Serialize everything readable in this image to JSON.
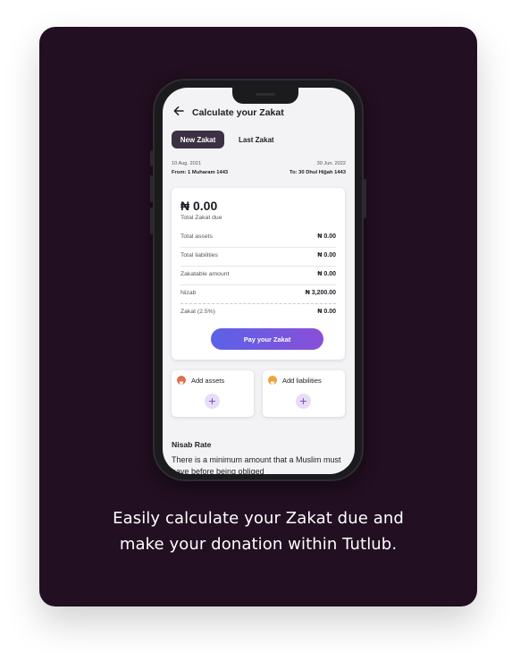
{
  "caption": {
    "line1": "Easily calculate your Zakat due and",
    "line2": "make your donation within Tutlub."
  },
  "app": {
    "header": {
      "title": "Calculate your Zakat",
      "back_icon": "arrow-left-icon"
    },
    "tabs": [
      {
        "label": "New Zakat",
        "active": true
      },
      {
        "label": "Last Zakat",
        "active": false
      }
    ],
    "dates": {
      "start_date": "10 Aug. 2021",
      "start_label": "From: 1 Muharam 1443",
      "end_date": "30 Jun. 2022",
      "end_label": "To: 30 Dhul Hijjah 1443"
    },
    "summary": {
      "amount": "₦ 0.00",
      "amount_label": "Total Zakat due",
      "rows": [
        {
          "label": "Total assets",
          "value": "₦ 0.00"
        },
        {
          "label": "Total liabilities",
          "value": "₦ 0.00"
        },
        {
          "label": "Zakatable amount",
          "value": "₦ 0.00"
        },
        {
          "label": "Nizab",
          "value": "₦ 3,200.00"
        },
        {
          "label": "Zakat (2.5%)",
          "value": "₦ 0.00"
        }
      ],
      "pay_button": "Pay your Zakat"
    },
    "actions": {
      "assets": {
        "label": "Add assets",
        "icon": "hand-heart-icon",
        "color": "#e0714e"
      },
      "liabilities": {
        "label": "Add liabilities",
        "icon": "hand-heart-icon",
        "color": "#f0a23a"
      },
      "plus": "+"
    },
    "nisab": {
      "title": "Nisab Rate",
      "text": "There is a minimum amount that a Muslim must have before being obliged"
    }
  },
  "colors": {
    "card_bg": "#220f21",
    "active_tab": "#3b3143",
    "pay_gradient_start": "#5b62e8",
    "pay_gradient_end": "#8a4fd8"
  }
}
